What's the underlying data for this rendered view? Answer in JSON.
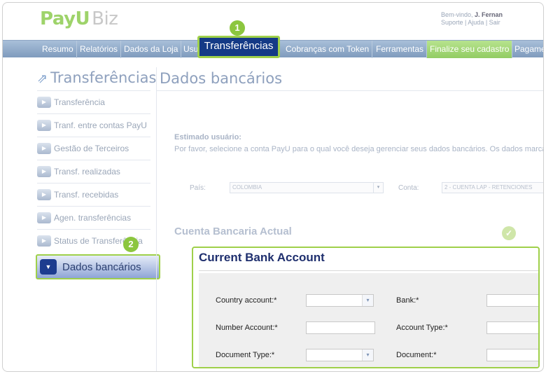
{
  "header": {
    "logo_payu": "PayU",
    "logo_biz": "Biz",
    "welcome_label": "Bem-vindo,",
    "user_name": "J. Fernan",
    "links": "Suporte | Ajuda | Sair"
  },
  "nav": {
    "items": [
      "Resumo",
      "Relatórios",
      "Dados da Loja",
      "Usu",
      "Cobranças com Token",
      "Ferramentas",
      "Finalize seu cadastro",
      "Pagame"
    ],
    "active": "Transferências"
  },
  "badges": {
    "one": "1",
    "two": "2"
  },
  "sidebar": {
    "title": "Transferências",
    "items": [
      "Transferência",
      "Tranf. entre contas PayU",
      "Gestão de Terceiros",
      "Transf. realizadas",
      "Transf. recebidas",
      "Agen. transferências",
      "Status de Transferência"
    ],
    "active": "Dados bancários"
  },
  "main": {
    "title": "Dados bancários",
    "greeting": "Estimado usuário:",
    "message": "Por favor, selecione a conta PayU para o qual você deseja gerenciar seus dados bancários. Os dados marcad",
    "country_label": "País:",
    "country_value": "COLOMBIA",
    "account_label": "Conta:",
    "account_value": "2 - CUENTA LAP - RETENCIONES",
    "section_title": "Cuenta Bancaria Actual"
  },
  "panel": {
    "title": "Current Bank Account",
    "country_account_label": "Country account:*",
    "bank_label": "Bank:*",
    "number_account_label": "Number Account:*",
    "account_type_label": "Account Type:*",
    "document_type_label": "Document Type:*",
    "document_label": "Document:*"
  },
  "colors": {
    "highlight": "#9fd04a",
    "active_bg": "#143a86",
    "nav_bg": "#8fa9c8"
  }
}
